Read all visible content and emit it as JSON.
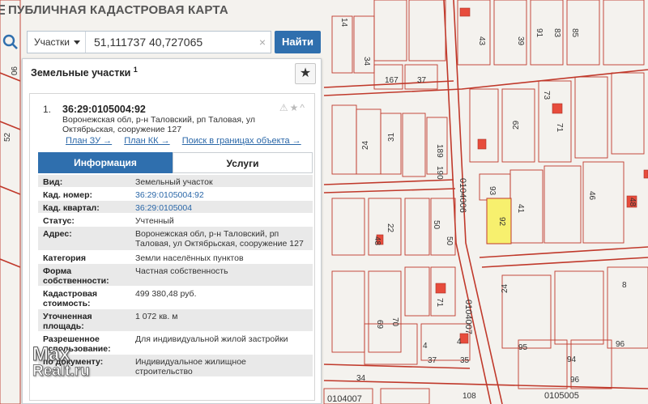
{
  "app": {
    "title": "ПУБЛИЧНАЯ КАДАСТРОВАЯ КАРТА"
  },
  "search": {
    "type_label": "Участки",
    "value": "51,111737 40,727065",
    "clear": "×",
    "button": "Найти"
  },
  "panel": {
    "title": "Земельные участки",
    "count": "1",
    "star": "★",
    "result": {
      "number": "1.",
      "id": "36:29:0105004:92",
      "address": "Воронежская обл, р-н Таловский, рп Таловая, ул Октябрьская, сооружение 127",
      "icons": "⚠★^",
      "links": [
        "План ЗУ →",
        "План КК →",
        "Поиск в границах объекта →"
      ]
    },
    "tabs": [
      "Информация",
      "Услуги"
    ],
    "rows": [
      {
        "k": "Вид:",
        "v": "Земельный участок"
      },
      {
        "k": "Кад. номер:",
        "v": "36:29:0105004:92"
      },
      {
        "k": "Кад. квартал:",
        "v": "36:29:0105004"
      },
      {
        "k": "Статус:",
        "v": "Учтенный"
      },
      {
        "k": "Адрес:",
        "v": "Воронежская обл, р-н Таловский, рп Таловая, ул Октябрьская, сооружение 127"
      },
      {
        "k": "Категория земель:",
        "v": "Земли населённых пунктов"
      },
      {
        "k": "Форма собственности:",
        "v": "Частная собственность"
      },
      {
        "k": "Кадастровая стоимость:",
        "v": "499 380,48 руб."
      },
      {
        "k": "Уточненная площадь:",
        "v": "1 072 кв. м"
      },
      {
        "k": "Разрешенное использование:",
        "v": "Для индивидуальной жилой застройки"
      },
      {
        "k": "по документу:",
        "v": "Индивидуальное жилищное строительство"
      }
    ]
  },
  "map": {
    "labels": [
      "167",
      "37",
      "43",
      "39",
      "91",
      "83",
      "85",
      "14",
      "34",
      "90",
      "52",
      "73",
      "29",
      "71",
      "24",
      "31",
      "189",
      "190",
      "0104006",
      "93",
      "92",
      "41",
      "46",
      "22",
      "48",
      "50",
      "50",
      "8",
      "24",
      "71",
      "69",
      "70",
      "0104007",
      "4",
      "4",
      "37",
      "35",
      "34",
      "95",
      "94",
      "96",
      "108",
      "0104007",
      "0105005",
      "96",
      "48"
    ],
    "highlight_color": "#f7f06e",
    "line_color": "#c0392b"
  },
  "watermark": {
    "line1": "Max",
    "line2": "Realt.ru"
  }
}
